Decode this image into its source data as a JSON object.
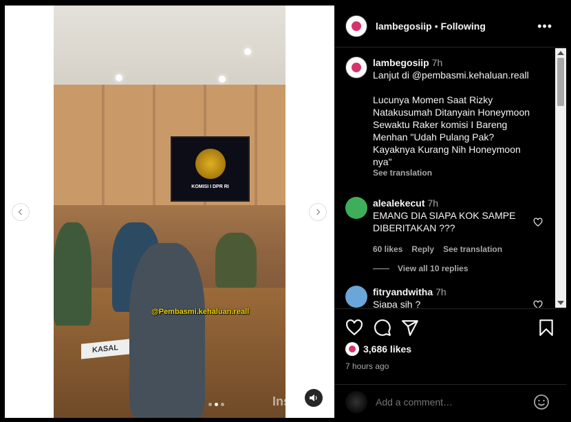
{
  "post": {
    "video_overlay_tag": "@Pembasmi.kehaluan.reall",
    "nameplate": "KASAL",
    "tv_caption": "KOMISI I DPR RI",
    "watermark": "Insta",
    "carousel_dots": 3,
    "carousel_active_index": 1
  },
  "header": {
    "username": "lambegosiip",
    "separator": "•",
    "follow_label": "Following",
    "more_icon": "more-horizontal-icon"
  },
  "caption": {
    "username": "lambegosiip",
    "time": "7h",
    "text": "Lanjut di @pembasmi.kehaluan.reall\n\nLucunya Momen Saat Rizky Natakusumah Ditanyain Honeymoon Sewaktu Raker komisi I Bareng Menhan \"Udah Pulang Pak? Kayaknya Kurang Nih Honeymoon nya\"",
    "see_translation": "See translation"
  },
  "comments": [
    {
      "username": "alealekecut",
      "time": "7h",
      "text": "EMANG DIA SIAPA KOK SAMPE DIBERITAKAN ???",
      "likes": "60 likes",
      "reply": "Reply",
      "see_translation": "See translation",
      "view_replies": "View all 10 replies",
      "avatar_color": "#3fae5a"
    },
    {
      "username": "fitryandwitha",
      "time": "7h",
      "text": "Siapa sih ?",
      "avatar_color": "#6aa6d8"
    }
  ],
  "footer": {
    "likes_count": "3,686 likes",
    "posted_ago": "7 hours ago",
    "comment_placeholder": "Add a comment…"
  },
  "colors": {
    "background": "#000000",
    "text_primary": "#f5f5f5",
    "text_secondary": "#a8a8a8",
    "overlay_tag": "#f2d600"
  }
}
